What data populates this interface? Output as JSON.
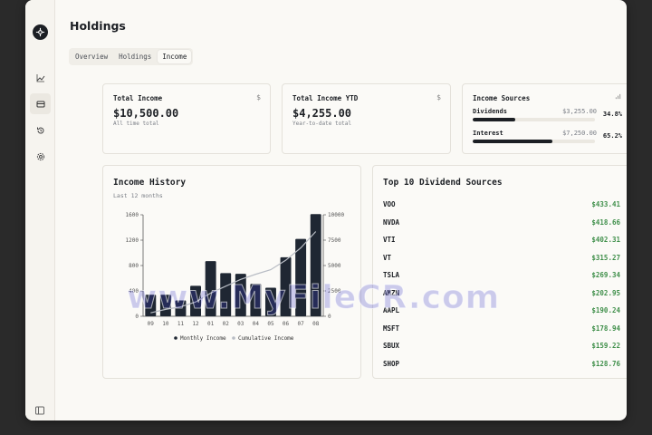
{
  "page": {
    "title": "Holdings"
  },
  "tabs": [
    {
      "label": "Overview",
      "active": false
    },
    {
      "label": "Holdings",
      "active": false
    },
    {
      "label": "Income",
      "active": true
    }
  ],
  "cards": {
    "total_income": {
      "label": "Total Income",
      "icon": "$",
      "value": "$10,500.00",
      "sub": "All time total"
    },
    "total_ytd": {
      "label": "Total Income YTD",
      "icon": "$",
      "value": "$4,255.00",
      "sub": "Year-to-date total"
    },
    "sources": {
      "label": "Income Sources",
      "icon": "bar-chart-icon",
      "items": [
        {
          "name": "Dividends",
          "amount": "$3,255.00",
          "pct": "34.8%",
          "fill": 0.348
        },
        {
          "name": "Interest",
          "amount": "$7,250.00",
          "pct": "65.2%",
          "fill": 0.652
        }
      ]
    }
  },
  "history": {
    "title": "Income History",
    "subtitle": "Last 12 months"
  },
  "chart_data": {
    "type": "bar",
    "categories": [
      "09",
      "10",
      "11",
      "12",
      "01",
      "02",
      "03",
      "04",
      "05",
      "06",
      "07",
      "08"
    ],
    "series": [
      {
        "name": "Monthly Income",
        "type": "bar",
        "axis": "left",
        "color": "#1f2733",
        "values": [
          340,
          340,
          250,
          480,
          870,
          680,
          670,
          510,
          450,
          930,
          1220,
          1610
        ]
      },
      {
        "name": "Cumulative Income",
        "type": "line",
        "axis": "right",
        "color": "#b8bcc4",
        "values": [
          340,
          680,
          930,
          1410,
          2280,
          2960,
          3630,
          4140,
          4590,
          5520,
          6740,
          8350
        ]
      }
    ],
    "ylim_left": [
      0,
      1600
    ],
    "yticks_left": [
      "0",
      "400",
      "800",
      "1200",
      "1600"
    ],
    "ylim_right": [
      0,
      10000
    ],
    "yticks_right": [
      "0",
      "2500",
      "5000",
      "7500",
      "10000"
    ],
    "legend": "bottom",
    "grid": false
  },
  "dividends": {
    "title": "Top 10 Dividend Sources",
    "rows": [
      {
        "symbol": "VOO",
        "value": "$433.41"
      },
      {
        "symbol": "NVDA",
        "value": "$418.66"
      },
      {
        "symbol": "VTI",
        "value": "$402.31"
      },
      {
        "symbol": "VT",
        "value": "$315.27"
      },
      {
        "symbol": "TSLA",
        "value": "$269.34"
      },
      {
        "symbol": "AMZN",
        "value": "$202.95"
      },
      {
        "symbol": "AAPL",
        "value": "$190.24"
      },
      {
        "symbol": "MSFT",
        "value": "$178.94"
      },
      {
        "symbol": "SBUX",
        "value": "$159.22"
      },
      {
        "symbol": "SHOP",
        "value": "$128.76"
      }
    ]
  },
  "watermark": "www.MyFileCR.com",
  "colors": {
    "accent": "#1c1f24",
    "positive": "#3f8f4a",
    "background": "#faf9f5"
  }
}
